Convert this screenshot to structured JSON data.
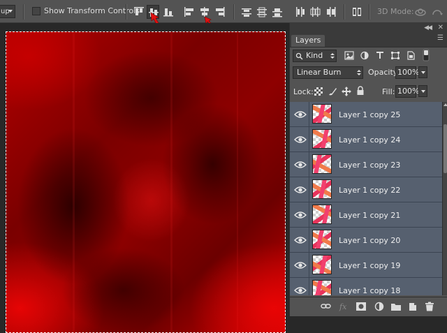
{
  "options_bar": {
    "group_dropdown": "up",
    "show_transform_controls_label": "Show Transform Controls",
    "show_transform_controls_checked": false,
    "mode_3d_label": "3D Mode:",
    "icons": [
      "align-top-edges-icon",
      "align-vertical-centers-icon",
      "align-bottom-edges-icon",
      "align-left-edges-icon",
      "align-horizontal-centers-icon",
      "align-right-edges-icon",
      "distribute-top-icon",
      "distribute-vertical-centers-icon",
      "distribute-bottom-icon",
      "distribute-left-icon",
      "distribute-horizontal-centers-icon",
      "distribute-right-icon",
      "auto-align-layers-icon",
      "3d-orbit-icon",
      "3d-roll-icon"
    ]
  },
  "layers_panel": {
    "tab_label": "Layers",
    "filter": {
      "kind_label": "Kind"
    },
    "blend_mode": "Linear Burn",
    "opacity_label": "Opacity:",
    "opacity_value": "100%",
    "lock_label": "Lock:",
    "fill_label": "Fill:",
    "fill_value": "100%",
    "layers": [
      {
        "name": "Layer 1 copy 25",
        "visible": true
      },
      {
        "name": "Layer 1 copy 24",
        "visible": true
      },
      {
        "name": "Layer 1 copy 23",
        "visible": true
      },
      {
        "name": "Layer 1 copy 22",
        "visible": true
      },
      {
        "name": "Layer 1 copy 21",
        "visible": true
      },
      {
        "name": "Layer 1 copy 20",
        "visible": true
      },
      {
        "name": "Layer 1 copy 19",
        "visible": true
      },
      {
        "name": "Layer 1 copy 18",
        "visible": true
      }
    ],
    "bottom_icons": [
      "link-layers-icon",
      "fx-icon",
      "add-mask-icon",
      "adjustment-layer-icon",
      "new-group-icon",
      "new-layer-icon",
      "delete-layer-icon"
    ]
  },
  "colors": {
    "panel_bg": "#535353",
    "layer_selected_bg": "#56606f",
    "annotation_arrow": "#e01010",
    "canvas_red": "#c00000"
  }
}
